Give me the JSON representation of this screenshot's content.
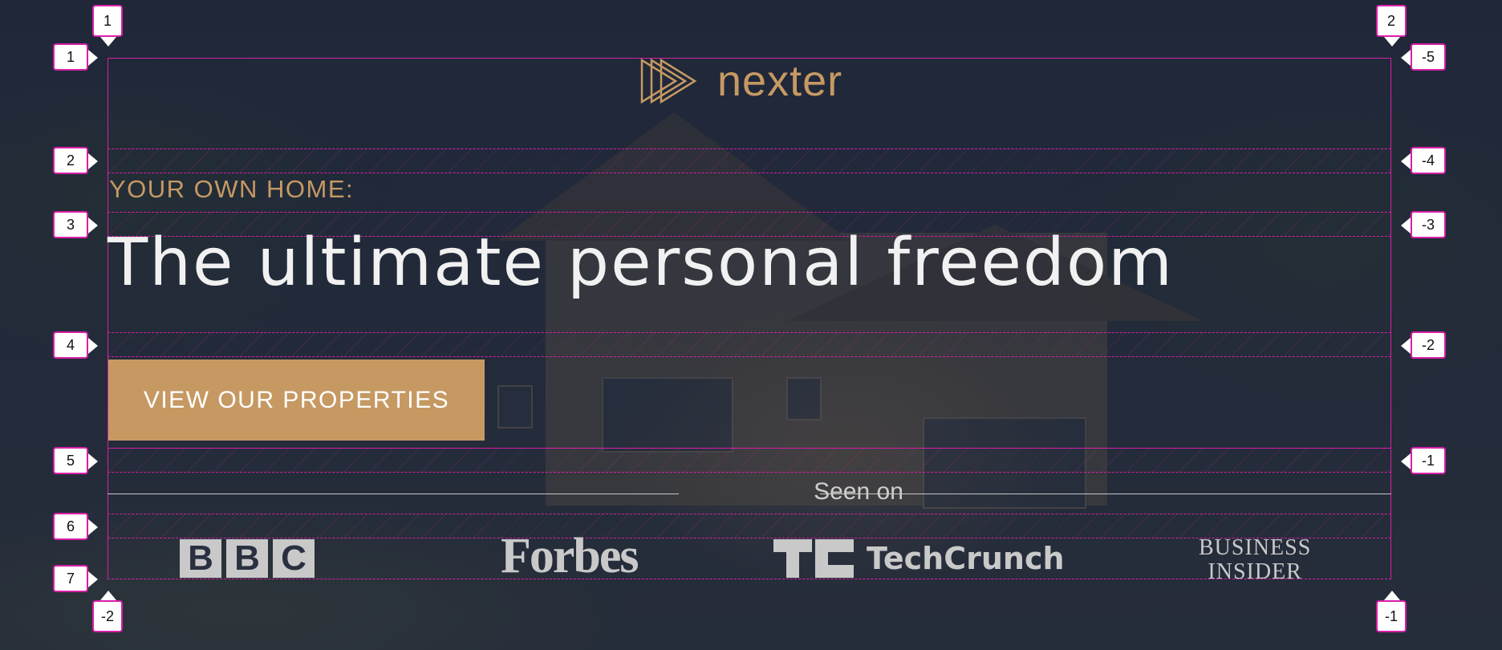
{
  "brand": {
    "name": "nexter",
    "color": "#c69963",
    "logo_icon": "triple-play-icon"
  },
  "hero": {
    "eyebrow": "YOUR OWN HOME:",
    "headline": "The ultimate personal freedom",
    "cta_label": "VIEW OUR PROPERTIES"
  },
  "seen_on": {
    "label": "Seen on",
    "logos": {
      "bbc": [
        "B",
        "B",
        "C"
      ],
      "forbes": "Forbes",
      "techcrunch": "TechCrunch",
      "business_insider": [
        "BUSINESS",
        "INSIDER"
      ]
    }
  },
  "guides": {
    "left": [
      "1",
      "2",
      "3",
      "4",
      "5",
      "6",
      "7"
    ],
    "right": [
      "-5",
      "-4",
      "-3",
      "-2",
      "-1"
    ],
    "top": [
      "1",
      "2"
    ],
    "bottom": [
      "-2",
      "-1"
    ]
  },
  "colors": {
    "accent": "#c69963",
    "overlay": "#d81fa8",
    "text": "#f1f1f1"
  }
}
